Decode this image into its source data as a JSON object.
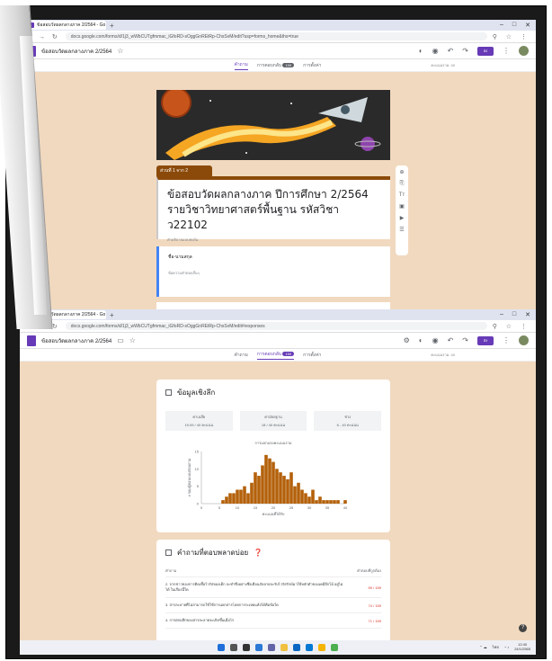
{
  "colors": {
    "accent": "#673ab7",
    "section": "#8b4a0a",
    "page_bg": "#f1d9bf",
    "bar": "#b4610b",
    "error": "#d93025"
  },
  "window1": {
    "tab_title": "ข้อสอบวัดผลกลางภาค 2/2564 - Go",
    "url": "docs.google.com/forms/d/1j3_wWbCUTgfmmac_iGfoRD-sOggGnREtRp-ChsSvM/edit?usp=forms_home&ths=true",
    "form_name": "ข้อสอบวัดผลกลางภาค 2/2564",
    "tabs": [
      {
        "label": "คำถาม"
      },
      {
        "label": "การตอบกลับ",
        "badge": "159"
      },
      {
        "label": "การตั้งค่า"
      }
    ],
    "points_label": "คะแนนรวม: 40",
    "send_label": "ส่ง",
    "section_tag": "ส่วนที่ 1 จาก 2",
    "title_line1": "ข้อสอบวัดผลกลางภาค ปีการศึกษา 2/2564",
    "title_line2": "รายวิชาวิทยาศาสตร์พื้นฐาน รหัสวิชา ว22102",
    "title_desc": "คำอธิบายแบบฟอร์ม",
    "question_title": "ชื่อ-นามสกุล",
    "question_placeholder": "ข้อความคำตอบสั้นๆ",
    "side_tools": [
      "⊕",
      "⎘",
      "Tт",
      "▣",
      "▶",
      "☰"
    ]
  },
  "window2": {
    "tab_title": "ข้อสอบวัดผลกลางภาค 2/2564 - Go",
    "url": "docs.google.com/forms/d/1j3_wWbCUTgfmmac_iGfoRD-sOggGnREtRp-ChsSvM/edit#responses",
    "form_name": "ข้อสอบวัดผลกลางภาค 2/2564",
    "tabs": [
      {
        "label": "คำถาม"
      },
      {
        "label": "การตอบกลับ",
        "badge": "159"
      },
      {
        "label": "การตั้งค่า"
      }
    ],
    "points_label": "คะแนนรวม: 40",
    "send_label": "ส่ง",
    "insights_title": "ข้อมูลเชิงลึก",
    "stats": [
      {
        "label": "ค่าเฉลี่ย",
        "value": "19.09 / 40 คะแนน"
      },
      {
        "label": "ค่ามัธยฐาน",
        "value": "18 / 40 คะแนน"
      },
      {
        "label": "ช่วง",
        "value": "6 - 40 คะแนน"
      }
    ],
    "chart_caption": "การแจกแจงคะแนนรวม",
    "freq_title": "คำถามที่ตอบพลาดบ่อย",
    "freq_col_q": "คำถาม",
    "freq_col_c": "คำตอบที่ถูกต้อง",
    "freq_rows": [
      {
        "q": "2. จากข่าวของการติดเชื้อไวรัสของเด็ก จะทำซึ่งอย่างซึ่งเตือนภัยลายจะรับไวรัสรักษ์มาใช้หลักตัวของเคมีอีกไม้ อยู่ไม่ได้ ในเรื่องนี้ใด",
        "c": "59 / 159"
      },
      {
        "q": "3. สารละลายที่ไม่สามารถใช้ใช้การแยกสารโดยการระเหยแห้งได้คือข้อใด",
        "c": "74 / 159"
      },
      {
        "q": "4. การตกผลึกของสารละลายจะเกิดขึ้นเมื่อไร",
        "c": "71 / 159"
      }
    ]
  },
  "chart_data": {
    "type": "bar",
    "title": "การแจกแจงคะแนนรวม",
    "xlabel": "คะแนนที่ได้รับ",
    "ylabel": "# ของผู้ตอบแบบสอบถาม",
    "xlim": [
      0,
      40
    ],
    "ylim": [
      0,
      15
    ],
    "xticks": [
      0,
      5,
      10,
      15,
      20,
      25,
      30,
      35,
      40
    ],
    "yticks": [
      0,
      5,
      10,
      15
    ],
    "x": [
      6,
      7,
      8,
      9,
      10,
      11,
      12,
      13,
      14,
      15,
      16,
      17,
      18,
      19,
      20,
      21,
      22,
      23,
      24,
      25,
      26,
      27,
      28,
      29,
      30,
      31,
      32,
      33,
      34,
      35,
      36,
      37,
      38,
      39,
      40
    ],
    "values": [
      1,
      2,
      3,
      3,
      4,
      4,
      5,
      3,
      6,
      9,
      8,
      11,
      14,
      13,
      12,
      10,
      9,
      8,
      7,
      9,
      5,
      6,
      4,
      3,
      2,
      4,
      1,
      2,
      1,
      1,
      1,
      1,
      1,
      0,
      1
    ],
    "grid": false
  },
  "taskbar": {
    "time": "12:40",
    "date": "24/1/2565",
    "lang": "ไทย"
  }
}
